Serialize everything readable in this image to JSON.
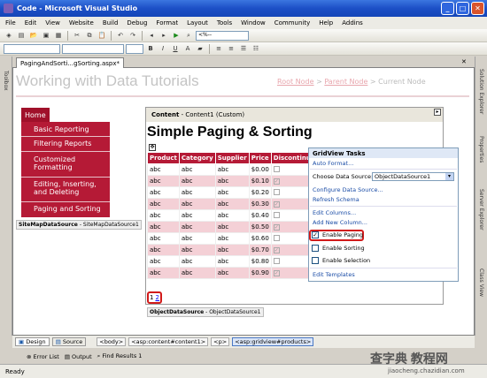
{
  "window": {
    "title": "Code - Microsoft Visual Studio"
  },
  "menu": [
    "File",
    "Edit",
    "View",
    "Website",
    "Build",
    "Debug",
    "Format",
    "Layout",
    "Tools",
    "Window",
    "Community",
    "Help",
    "Addins"
  ],
  "toolbar": {
    "combo_value": "<%--"
  },
  "side_panels": {
    "left": "Toolbox",
    "right": [
      "Solution Explorer",
      "Properties",
      "Server Explorer",
      "Class View"
    ]
  },
  "document": {
    "tab_label": "PagingAndSorti...gSorting.aspx*",
    "page_title": "Working with Data Tutorials",
    "breadcrumb": {
      "root": "Root Node",
      "sep": ">",
      "parent": "Parent Node",
      "current": "Current Node"
    },
    "nav": {
      "home": "Home",
      "items": [
        "Basic Reporting",
        "Filtering Reports",
        "Customized Formatting",
        "Editing, Inserting, and Deleting",
        "Paging and Sorting"
      ]
    },
    "sitemap_label": "SiteMapDataSource",
    "sitemap_id": "- SiteMapDataSource1",
    "content_label": "Content",
    "content_id": "- Content1 (Custom)",
    "heading": "Simple Paging & Sorting",
    "grid": {
      "headers": [
        "Product",
        "Category",
        "Supplier",
        "Price",
        "Discontinued"
      ],
      "rows": [
        [
          "abc",
          "abc",
          "abc",
          "$0.00"
        ],
        [
          "abc",
          "abc",
          "abc",
          "$0.10"
        ],
        [
          "abc",
          "abc",
          "abc",
          "$0.20"
        ],
        [
          "abc",
          "abc",
          "abc",
          "$0.30"
        ],
        [
          "abc",
          "abc",
          "abc",
          "$0.40"
        ],
        [
          "abc",
          "abc",
          "abc",
          "$0.50"
        ],
        [
          "abc",
          "abc",
          "abc",
          "$0.60"
        ],
        [
          "abc",
          "abc",
          "abc",
          "$0.70"
        ],
        [
          "abc",
          "abc",
          "abc",
          "$0.80"
        ],
        [
          "abc",
          "abc",
          "abc",
          "$0.90"
        ]
      ],
      "pager": [
        "1",
        "2"
      ]
    },
    "ods_label": "ObjectDataSource",
    "ods_id": "- ObjectDataSource1"
  },
  "tasks": {
    "title": "GridView Tasks",
    "auto_format": "Auto Format...",
    "choose_ds_label": "Choose Data Source:",
    "choose_ds_value": "ObjectDataSource1",
    "configure": "Configure Data Source...",
    "refresh": "Refresh Schema",
    "edit_columns": "Edit Columns...",
    "add_column": "Add New Column...",
    "enable_paging": "Enable Paging",
    "enable_sorting": "Enable Sorting",
    "enable_selection": "Enable Selection",
    "edit_templates": "Edit Templates"
  },
  "bottom": {
    "design": "Design",
    "source": "Source",
    "crumbs": [
      "<body>",
      "<asp:content#content1>",
      "<p>",
      "<asp:gridview#products>"
    ],
    "windows": [
      "Error List",
      "Output",
      "Find Results 1"
    ]
  },
  "status": "Ready",
  "watermark": {
    "main": "查字典 教程网",
    "sub": "jiaocheng.chazidian.com"
  }
}
